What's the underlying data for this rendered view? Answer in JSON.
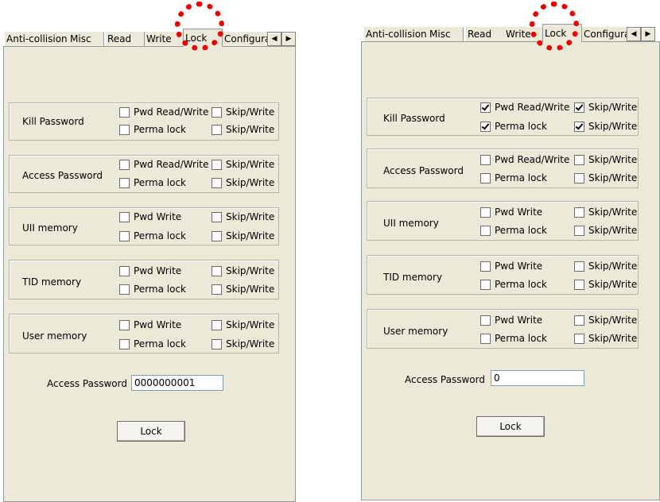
{
  "panels": [
    {
      "tabs": [
        "Anti-collision",
        "Misc",
        "Read",
        "Write",
        "Lock",
        "Configura"
      ],
      "active_tab": "Lock",
      "groups": [
        {
          "label": "Kill Password",
          "opt1": "Pwd Read/Write",
          "opt1_checked": false,
          "opt2": "Perma lock",
          "opt2_checked": false,
          "opt3": "Skip/Write",
          "opt3_checked": false,
          "opt4": "Skip/Write",
          "opt4_checked": false
        },
        {
          "label": "Access Password",
          "opt1": "Pwd Read/Write",
          "opt1_checked": false,
          "opt2": "Perma lock",
          "opt2_checked": false,
          "opt3": "Skip/Write",
          "opt3_checked": false,
          "opt4": "Skip/Write",
          "opt4_checked": false
        },
        {
          "label": "UII memory",
          "opt1": "Pwd Write",
          "opt1_checked": false,
          "opt2": "Perma lock",
          "opt2_checked": false,
          "opt3": "Skip/Write",
          "opt3_checked": false,
          "opt4": "Skip/Write",
          "opt4_checked": false
        },
        {
          "label": "TID memory",
          "opt1": "Pwd Write",
          "opt1_checked": false,
          "opt2": "Perma lock",
          "opt2_checked": false,
          "opt3": "Skip/Write",
          "opt3_checked": false,
          "opt4": "Skip/Write",
          "opt4_checked": false
        },
        {
          "label": "User memory",
          "opt1": "Pwd Write",
          "opt1_checked": false,
          "opt2": "Perma lock",
          "opt2_checked": false,
          "opt3": "Skip/Write",
          "opt3_checked": false,
          "opt4": "Skip/Write",
          "opt4_checked": false
        }
      ],
      "access_password_label": "Access Password",
      "access_password_value": "0000000001",
      "lock_button": "Lock"
    },
    {
      "tabs": [
        "Anti-collision",
        "Misc",
        "Read",
        "Write",
        "Lock",
        "Configura"
      ],
      "active_tab": "Lock",
      "groups": [
        {
          "label": "Kill Password",
          "opt1": "Pwd Read/Write",
          "opt1_checked": true,
          "opt2": "Perma lock",
          "opt2_checked": true,
          "opt3": "Skip/Write",
          "opt3_checked": true,
          "opt4": "Skip/Write",
          "opt4_checked": true
        },
        {
          "label": "Access Password",
          "opt1": "Pwd Read/Write",
          "opt1_checked": false,
          "opt2": "Perma lock",
          "opt2_checked": false,
          "opt3": "Skip/Write",
          "opt3_checked": false,
          "opt4": "Skip/Write",
          "opt4_checked": false
        },
        {
          "label": "UII memory",
          "opt1": "Pwd Write",
          "opt1_checked": false,
          "opt2": "Perma lock",
          "opt2_checked": false,
          "opt3": "Skip/Write",
          "opt3_checked": false,
          "opt4": "Skip/Write",
          "opt4_checked": false
        },
        {
          "label": "TID memory",
          "opt1": "Pwd Write",
          "opt1_checked": false,
          "opt2": "Perma lock",
          "opt2_checked": false,
          "opt3": "Skip/Write",
          "opt3_checked": false,
          "opt4": "Skip/Write",
          "opt4_checked": false
        },
        {
          "label": "User memory",
          "opt1": "Pwd Write",
          "opt1_checked": false,
          "opt2": "Perma lock",
          "opt2_checked": false,
          "opt3": "Skip/Write",
          "opt3_checked": false,
          "opt4": "Skip/Write",
          "opt4_checked": false
        }
      ],
      "access_password_label": "Access Password",
      "access_password_value": "0",
      "lock_button": "Lock"
    }
  ],
  "icons": {
    "scroll_left": "triangle-left-icon",
    "scroll_right": "triangle-right-icon",
    "annotation": "dotted-red-circle"
  },
  "colors": {
    "dialog_bg": "#ece9d8",
    "annotation": "#ee0000"
  }
}
